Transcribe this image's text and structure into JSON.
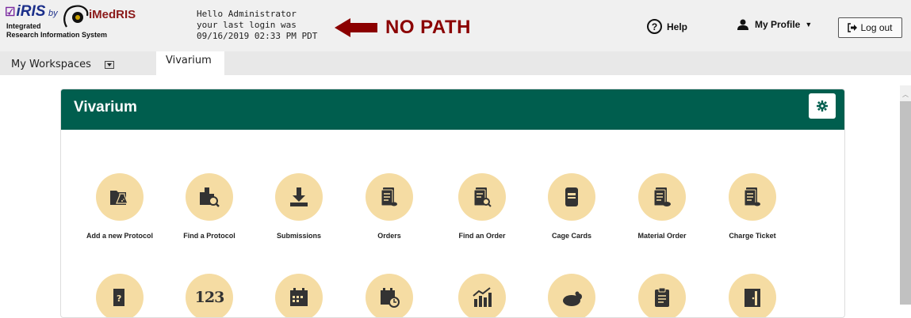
{
  "logo": {
    "check": "☑",
    "iris": "iRIS",
    "by": "by",
    "imedris": "iMedRIS",
    "sub1": "Integrated",
    "sub2": "Research Information System"
  },
  "greeting": {
    "line1": "Hello Administrator",
    "line2": "your last login was",
    "line3": "09/16/2019 02:33 PM PDT"
  },
  "annotation": {
    "text": "NO PATH",
    "color": "#8b0000"
  },
  "header_actions": {
    "help_label": "Help",
    "profile_label": "My Profile",
    "logout_label": "Log out"
  },
  "tabs": {
    "workspaces_label": "My Workspaces",
    "active_tab": "Vivarium"
  },
  "panel": {
    "title": "Vivarium",
    "accent": "#005e4e",
    "tile_color": "#f5dca3"
  },
  "tiles_row1": [
    {
      "label": "Add a new Protocol",
      "icon": "protocol-flask-icon"
    },
    {
      "label": "Find a Protocol",
      "icon": "find-protocol-icon"
    },
    {
      "label": "Submissions",
      "icon": "download-icon"
    },
    {
      "label": "Orders",
      "icon": "orders-document-icon"
    },
    {
      "label": "Find an Order",
      "icon": "find-order-icon"
    },
    {
      "label": "Cage Cards",
      "icon": "cage-card-icon"
    },
    {
      "label": "Material Order",
      "icon": "material-order-icon"
    },
    {
      "label": "Charge Ticket",
      "icon": "charge-ticket-icon"
    }
  ],
  "tiles_row2": [
    {
      "icon": "door-question-icon"
    },
    {
      "icon": "numbers-icon",
      "text": "123"
    },
    {
      "icon": "calendar-icon"
    },
    {
      "icon": "calendar-clock-icon"
    },
    {
      "icon": "chart-growth-icon"
    },
    {
      "icon": "rodent-icon"
    },
    {
      "icon": "clipboard-checklist-icon"
    },
    {
      "icon": "door-icon"
    }
  ]
}
